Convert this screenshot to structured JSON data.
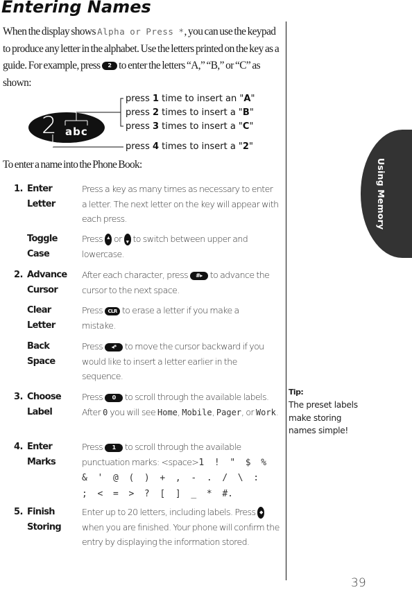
{
  "page": {
    "title": "Entering Names",
    "intro": {
      "part1": "When the display shows ",
      "lcd_text": "Alpha or Press *",
      "part2": ", you can use the keypad to produce any letter in the alphabet. Use the letters printed on the key as a guide. For example, press ",
      "key_label": "2",
      "part3": " to enter the letters “A,” “B,” or “C” as shown:"
    },
    "diagram": {
      "key_digit": "2",
      "key_letters": "abc",
      "callouts": [
        {
          "pre": "press ",
          "count": "1",
          "mid": " time to insert an \"",
          "result": "A",
          "post": "\""
        },
        {
          "pre": "press ",
          "count": "2",
          "mid": " times to insert a \"",
          "result": "B",
          "post": "\""
        },
        {
          "pre": "press ",
          "count": "3",
          "mid": " times to insert a \"",
          "result": "C",
          "post": "\""
        },
        {
          "pre": "press ",
          "count": "4",
          "mid": " times to insert a \"",
          "result": "2",
          "post": "\""
        }
      ]
    },
    "subhead": "To enter a name into the Phone Book:",
    "steps": [
      {
        "num": "1.",
        "label1": "Enter",
        "label2": "Letter",
        "text": "Press a key as many times as necessary to enter a letter. The next letter on the key will appear with each press."
      },
      {
        "num": "",
        "label1": "Toggle",
        "label2": "Case",
        "pre": "Press ",
        "or": " or ",
        "post": "  to switch between upper and lowercase.",
        "key_up": "up-arrow",
        "key_down": "down-arrow"
      },
      {
        "num": "2.",
        "label1": "Advance",
        "label2": "Cursor",
        "pre": "After each character, press ",
        "key": "#▸",
        "post": " to advance the cursor to the next space."
      },
      {
        "num": "",
        "label1": "Clear",
        "label2": "Letter",
        "pre": "Press ",
        "key": "CLR",
        "post": " to erase a letter if you make a mistake."
      },
      {
        "num": "",
        "label1": "Back",
        "label2": "Space",
        "pre": "Press ",
        "key": "◂*",
        "post": " to move the cursor backward if you would like to insert a letter earlier in the sequence."
      },
      {
        "num": "3.",
        "label1": "Choose",
        "label2": "Label",
        "pre": "Press ",
        "key": "0",
        "mid": " to scroll through the available labels. After ",
        "lcd0": "0",
        "mid2": " you will see ",
        "lcd_home": "Home",
        "c1": ", ",
        "lcd_mobile": "Mobile",
        "c2": ", ",
        "lcd_pager": "Pager",
        "c3": ", or ",
        "lcd_work": "Work",
        "end": "."
      },
      {
        "num": "4.",
        "label1": "Enter",
        "label2": "Marks",
        "pre": "Press ",
        "key": "1",
        "mid": " to scroll through the available punctuation marks: <space>",
        "marks": "1  !  \"  $  %\n&  '  @  (  )  +  ,  -  .  /  \\  :\n;  <  =  >  ?  [  ]  _  *  #."
      },
      {
        "num": "5.",
        "label1": "Finish",
        "label2": "Storing",
        "pre": "Enter up to 20 letters, including labels. Press ",
        "key": "ok",
        "post": "  when you are finished. Your phone will confirm the entry by displaying the information stored."
      }
    ],
    "side_tab": "Using Memory",
    "tip": {
      "title": "Tip:",
      "lines": [
        "The preset labels",
        "make storing",
        "names simple!"
      ]
    },
    "page_number": "39"
  }
}
